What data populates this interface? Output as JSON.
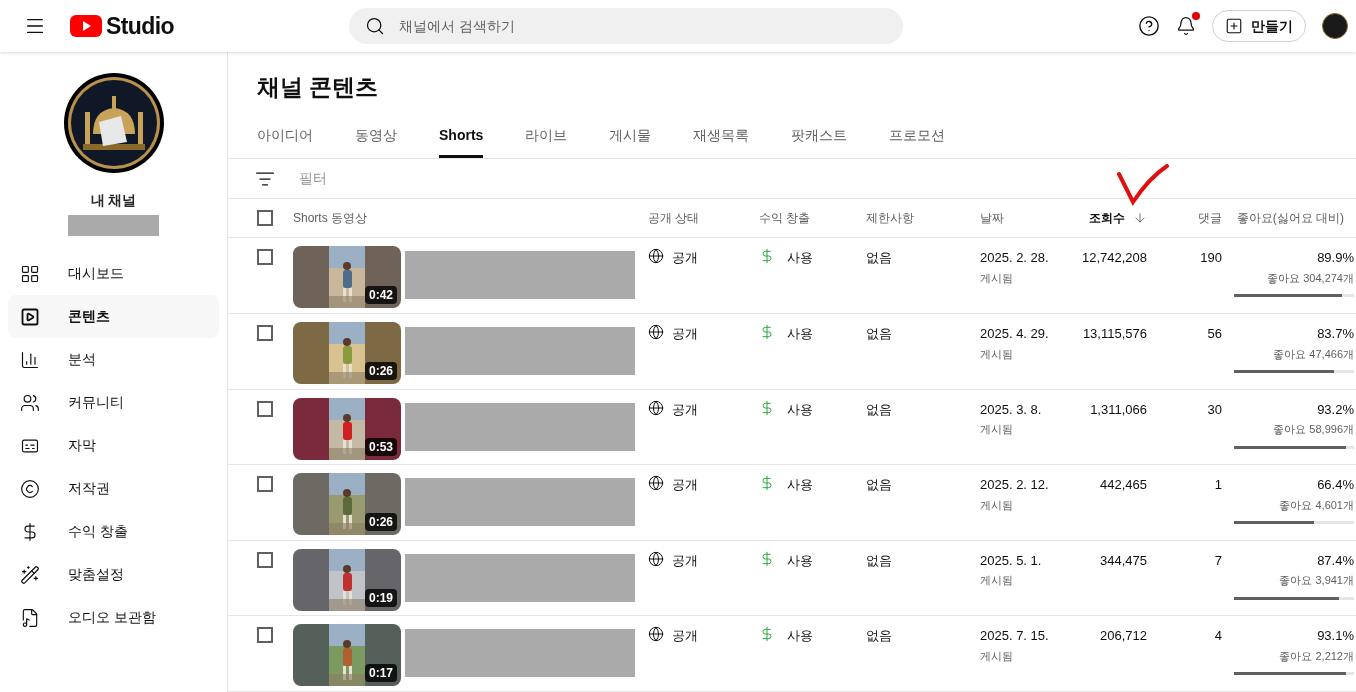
{
  "header": {
    "logo_text": "Studio",
    "search": {
      "placeholder": "채널에서 검색하기"
    },
    "notification_dot": true,
    "create_button": "만들기"
  },
  "sidebar": {
    "channel_label": "내 채널",
    "items": [
      {
        "label": "대시보드",
        "selected": false
      },
      {
        "label": "콘텐츠",
        "selected": true
      },
      {
        "label": "분석",
        "selected": false
      },
      {
        "label": "커뮤니티",
        "selected": false
      },
      {
        "label": "자막",
        "selected": false
      },
      {
        "label": "저작권",
        "selected": false
      },
      {
        "label": "수익 창출",
        "selected": false
      },
      {
        "label": "맞춤설정",
        "selected": false
      },
      {
        "label": "오디오 보관함",
        "selected": false
      }
    ]
  },
  "page_title": "채널 콘텐츠",
  "tabs": [
    {
      "label": "아이디어",
      "selected": false
    },
    {
      "label": "동영상",
      "selected": false
    },
    {
      "label": "Shorts",
      "selected": true
    },
    {
      "label": "라이브",
      "selected": false
    },
    {
      "label": "게시물",
      "selected": false
    },
    {
      "label": "재생목록",
      "selected": false
    },
    {
      "label": "팟캐스트",
      "selected": false
    },
    {
      "label": "프로모션",
      "selected": false
    }
  ],
  "filter": {
    "placeholder": "필터"
  },
  "table": {
    "select_all_checked": false,
    "columns": [
      {
        "label": "Shorts 동영상",
        "sorted": false
      },
      {
        "label": "공개 상태",
        "sorted": false
      },
      {
        "label": "수익 창출",
        "sorted": false
      },
      {
        "label": "제한사항",
        "sorted": false
      },
      {
        "label": "날짜",
        "sorted": false
      },
      {
        "label": "조회수",
        "sorted": true
      },
      {
        "label": "댓글",
        "sorted": false
      },
      {
        "label": "좋아요(싫어요 대비)",
        "sorted": false
      }
    ],
    "rows": [
      {
        "checked": false,
        "duration": "0:42",
        "visibility": "공개",
        "monetization": "사용",
        "restrictions": "없음",
        "date": "2025. 2. 28.",
        "date_status": "게시됨",
        "views": "12,742,208",
        "comments": "190",
        "like_ratio": "89.9%",
        "likes": "좋아요 304,274개",
        "level": 0.899
      },
      {
        "checked": false,
        "duration": "0:26",
        "visibility": "공개",
        "monetization": "사용",
        "restrictions": "없음",
        "date": "2025. 4. 29.",
        "date_status": "게시됨",
        "views": "13,115,576",
        "comments": "56",
        "like_ratio": "83.7%",
        "likes": "좋아요 47,466개",
        "level": 0.837
      },
      {
        "checked": false,
        "duration": "0:53",
        "visibility": "공개",
        "monetization": "사용",
        "restrictions": "없음",
        "date": "2025. 3. 8.",
        "date_status": "게시됨",
        "views": "1,311,066",
        "comments": "30",
        "like_ratio": "93.2%",
        "likes": "좋아요 58,996개",
        "level": 0.932
      },
      {
        "checked": false,
        "duration": "0:26",
        "visibility": "공개",
        "monetization": "사용",
        "restrictions": "없음",
        "date": "2025. 2. 12.",
        "date_status": "게시됨",
        "views": "442,465",
        "comments": "1",
        "like_ratio": "66.4%",
        "likes": "좋아요 4,601개",
        "level": 0.664
      },
      {
        "checked": false,
        "duration": "0:19",
        "visibility": "공개",
        "monetization": "사용",
        "restrictions": "없음",
        "date": "2025. 5. 1.",
        "date_status": "게시됨",
        "views": "344,475",
        "comments": "7",
        "like_ratio": "87.4%",
        "likes": "좋아요 3,941개",
        "level": 0.874
      },
      {
        "checked": false,
        "duration": "0:17",
        "visibility": "공개",
        "monetization": "사용",
        "restrictions": "없음",
        "date": "2025. 7. 15.",
        "date_status": "게시됨",
        "views": "206,712",
        "comments": "4",
        "like_ratio": "93.1%",
        "likes": "좋아요 2,212개",
        "level": 0.931
      }
    ]
  }
}
